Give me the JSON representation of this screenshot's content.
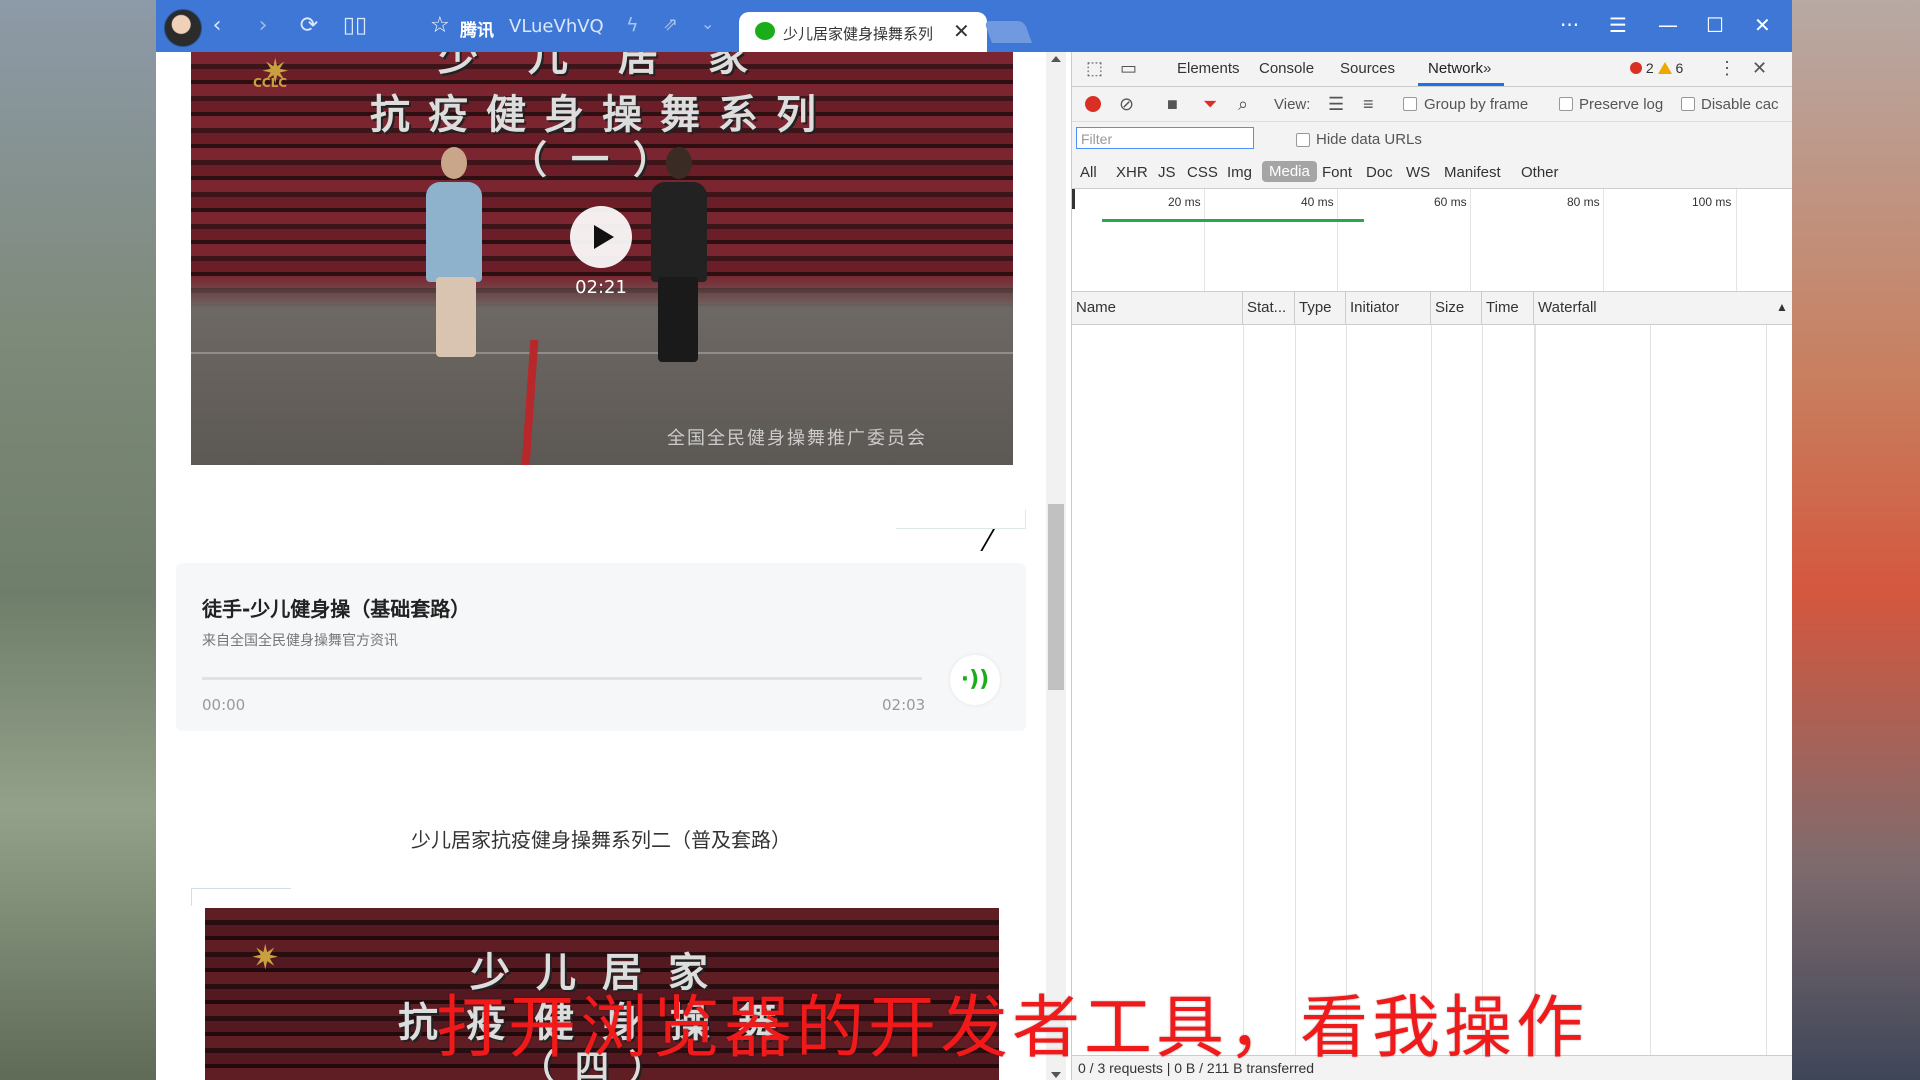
{
  "browser": {
    "site_label": "腾讯",
    "url_text": "VLueVhVQ",
    "tab_title": "少儿居家健身操舞系列",
    "more_label": "···"
  },
  "video1": {
    "title_line1": "少 儿 居 家",
    "title_line2": "抗疫健身操舞系列",
    "title_line3": "（一）",
    "logo_text": "CCLC",
    "duration": "02:21",
    "watermark": "全国全民健身操舞推广委员会"
  },
  "audio": {
    "title": "徒手-少儿健身操（基础套路）",
    "source": "来自全国全民健身操舞官方资讯",
    "current_time": "00:00",
    "total_time": "02:03",
    "progress": 0
  },
  "section2": {
    "title": "少儿居家抗疫健身操舞系列二（普及套路）"
  },
  "video2": {
    "title_line1": "少儿居家",
    "title_line2": "抗疫健身操舞",
    "title_line3": "（四）"
  },
  "devtools": {
    "tabs": [
      "Elements",
      "Console",
      "Sources",
      "Network"
    ],
    "active_tab": "Network",
    "more_tabs": "»",
    "error_count": "2",
    "warning_count": "6",
    "view_label": "View:",
    "group_by_frame": "Group by frame",
    "preserve_log": "Preserve log",
    "disable_cache": "Disable cac",
    "filter_placeholder": "Filter",
    "hide_data_urls": "Hide data URLs",
    "types": [
      "All",
      "XHR",
      "JS",
      "CSS",
      "Img",
      "Media",
      "Font",
      "Doc",
      "WS",
      "Manifest",
      "Other"
    ],
    "active_type": "Media",
    "timeline_labels": [
      "20 ms",
      "40 ms",
      "60 ms",
      "80 ms",
      "100 ms"
    ],
    "columns": [
      "Name",
      "Stat...",
      "Type",
      "Initiator",
      "Size",
      "Time",
      "Waterfall"
    ],
    "status": "0 / 3 requests | 0 B / 211 B transferred"
  },
  "overlay_subtitle": "打开浏览器的开发者工具，看我操作",
  "colors": {
    "titlebar": "#3f77d6",
    "accent_green": "#1aad19",
    "record_red": "#d93025",
    "subtitle_red": "#f01a1a"
  }
}
